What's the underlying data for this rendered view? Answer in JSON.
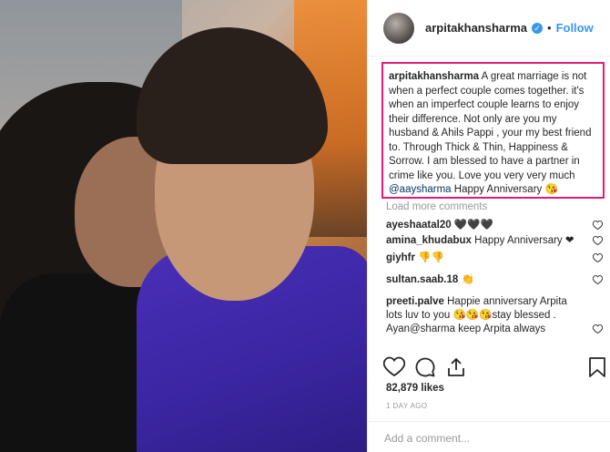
{
  "header": {
    "username": "arpitakhansharma",
    "separator": "•",
    "follow_label": "Follow",
    "verified_icon": "verified-badge-icon"
  },
  "caption": {
    "username": "arpitakhansharma",
    "text": " A great marriage is not when a perfect couple comes together. it's when an imperfect couple learns to enjoy their difference. Not only are you my husband & Ahils Pappi , your my best friend to. Through Thick & Thin, Happiness & Sorrow. I am blessed to have a partner in crime like you. Love you very very much ",
    "mention": "@aaysharma",
    "tail": " Happy Anniversary 😘"
  },
  "load_more_label": "Load more comments",
  "comments": [
    {
      "user": "ayeshaatal20",
      "text": " 🖤🖤🖤"
    },
    {
      "user": "amina_khudabux",
      "text": " Happy Anniversary ❤"
    },
    {
      "user": "giyhfr",
      "text": " 👎👎"
    },
    {
      "user": "sultan.saab.18",
      "text": " 👏"
    },
    {
      "user": "preeti.palve",
      "text": " Happie anniversary Arpita lots luv to you 😘😘😘stay blessed . Ayan@sharma keep Arpita always"
    }
  ],
  "likes": "82,879 likes",
  "timestamp": "1 DAY AGO",
  "add_comment_placeholder": "Add a comment...",
  "colors": {
    "accent": "#3897f0",
    "highlight_border": "#e61a76",
    "text": "#262626",
    "muted": "#999999"
  }
}
